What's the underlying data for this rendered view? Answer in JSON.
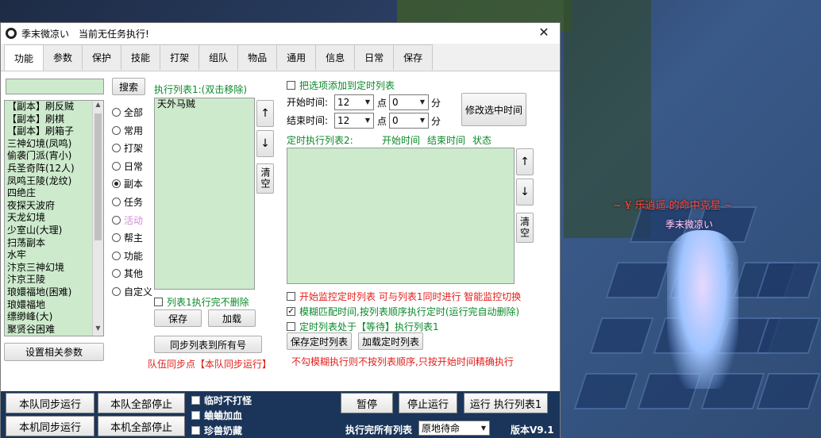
{
  "window": {
    "title": "季末微凉い",
    "status": "当前无任务执行!",
    "close_glyph": "✕"
  },
  "tabs": [
    "功能",
    "参数",
    "保护",
    "技能",
    "打架",
    "组队",
    "物品",
    "通用",
    "信息",
    "日常",
    "保存"
  ],
  "left": {
    "search_value": "",
    "search_button": "搜索",
    "list_items": [
      "【副本】刷反贼",
      "【副本】刷棋",
      "【副本】刷箱子",
      "三神幻境(凤鸣)",
      "偷袭门派(宵小)",
      "兵圣奇阵(12人)",
      "凤鸣王陵(龙纹)",
      "四绝庄",
      "夜探天波府",
      "天龙幻境",
      "少室山(大理)",
      "扫荡副本",
      "水牢",
      "汴京三神幻境",
      "汴京王陵",
      "琅嬛福地(困难)",
      "琅嬛福地",
      "缥缈峰(大)",
      "聚贤谷困难"
    ],
    "settings_button": "设置相关参数"
  },
  "categories": {
    "items": [
      "全部",
      "常用",
      "打架",
      "日常",
      "副本",
      "任务",
      "活动",
      "帮主",
      "功能",
      "其他",
      "自定义"
    ],
    "selected": "副本",
    "disabled": "活动"
  },
  "exec_list": {
    "title": "执行列表1:(双击移除)",
    "items": [
      "天外马贼"
    ],
    "up": "↑",
    "down": "↓",
    "clear": "清空",
    "no_delete_label": "列表1执行完不删除",
    "save": "保存",
    "load": "加载",
    "sync_all": "同步列表到所有号",
    "team_sync_note": "队伍同步点【本队同步运行】"
  },
  "timer": {
    "add_label": "把选项添加到定时列表",
    "start_label": "开始时间:",
    "end_label": "结束时间:",
    "start_hour": "12",
    "start_min": "0",
    "end_hour": "12",
    "end_min": "0",
    "hour_unit": "点",
    "min_unit": "分",
    "modify_button": "修改选中时间",
    "list_title": "定时执行列表2:",
    "col_start": "开始时间",
    "col_end": "结束时间",
    "col_status": "状态",
    "up": "↑",
    "down": "↓",
    "clear": "清空",
    "opt1": "开始监控定时列表 可与列表1同时进行 智能监控切换",
    "opt2": "模糊匹配时间,按列表顺序执行定时(运行完自动删除)",
    "opt3": "定时列表处于【等待】执行列表1",
    "save": "保存定时列表",
    "load": "加载定时列表",
    "note": "不勾模糊执行则不按列表顺序,只按开始时间精确执行"
  },
  "bottom": {
    "team_sync_run": "本队同步运行",
    "team_stop_all": "本队全部停止",
    "local_sync_run": "本机同步运行",
    "local_stop_all": "本机全部停止",
    "chk1": "临时不打怪",
    "chk2": "蛐蛐加血",
    "chk3": "珍兽奶藏",
    "pause": "暂停",
    "stop": "停止运行",
    "run_list": "运行 执行列表1",
    "after_label": "执行完所有列表",
    "after_value": "原地待命",
    "version": "版本V9.1"
  },
  "scene": {
    "nameplate": "乐逍遥 的命中克星",
    "player_name": "季末微凉い"
  }
}
